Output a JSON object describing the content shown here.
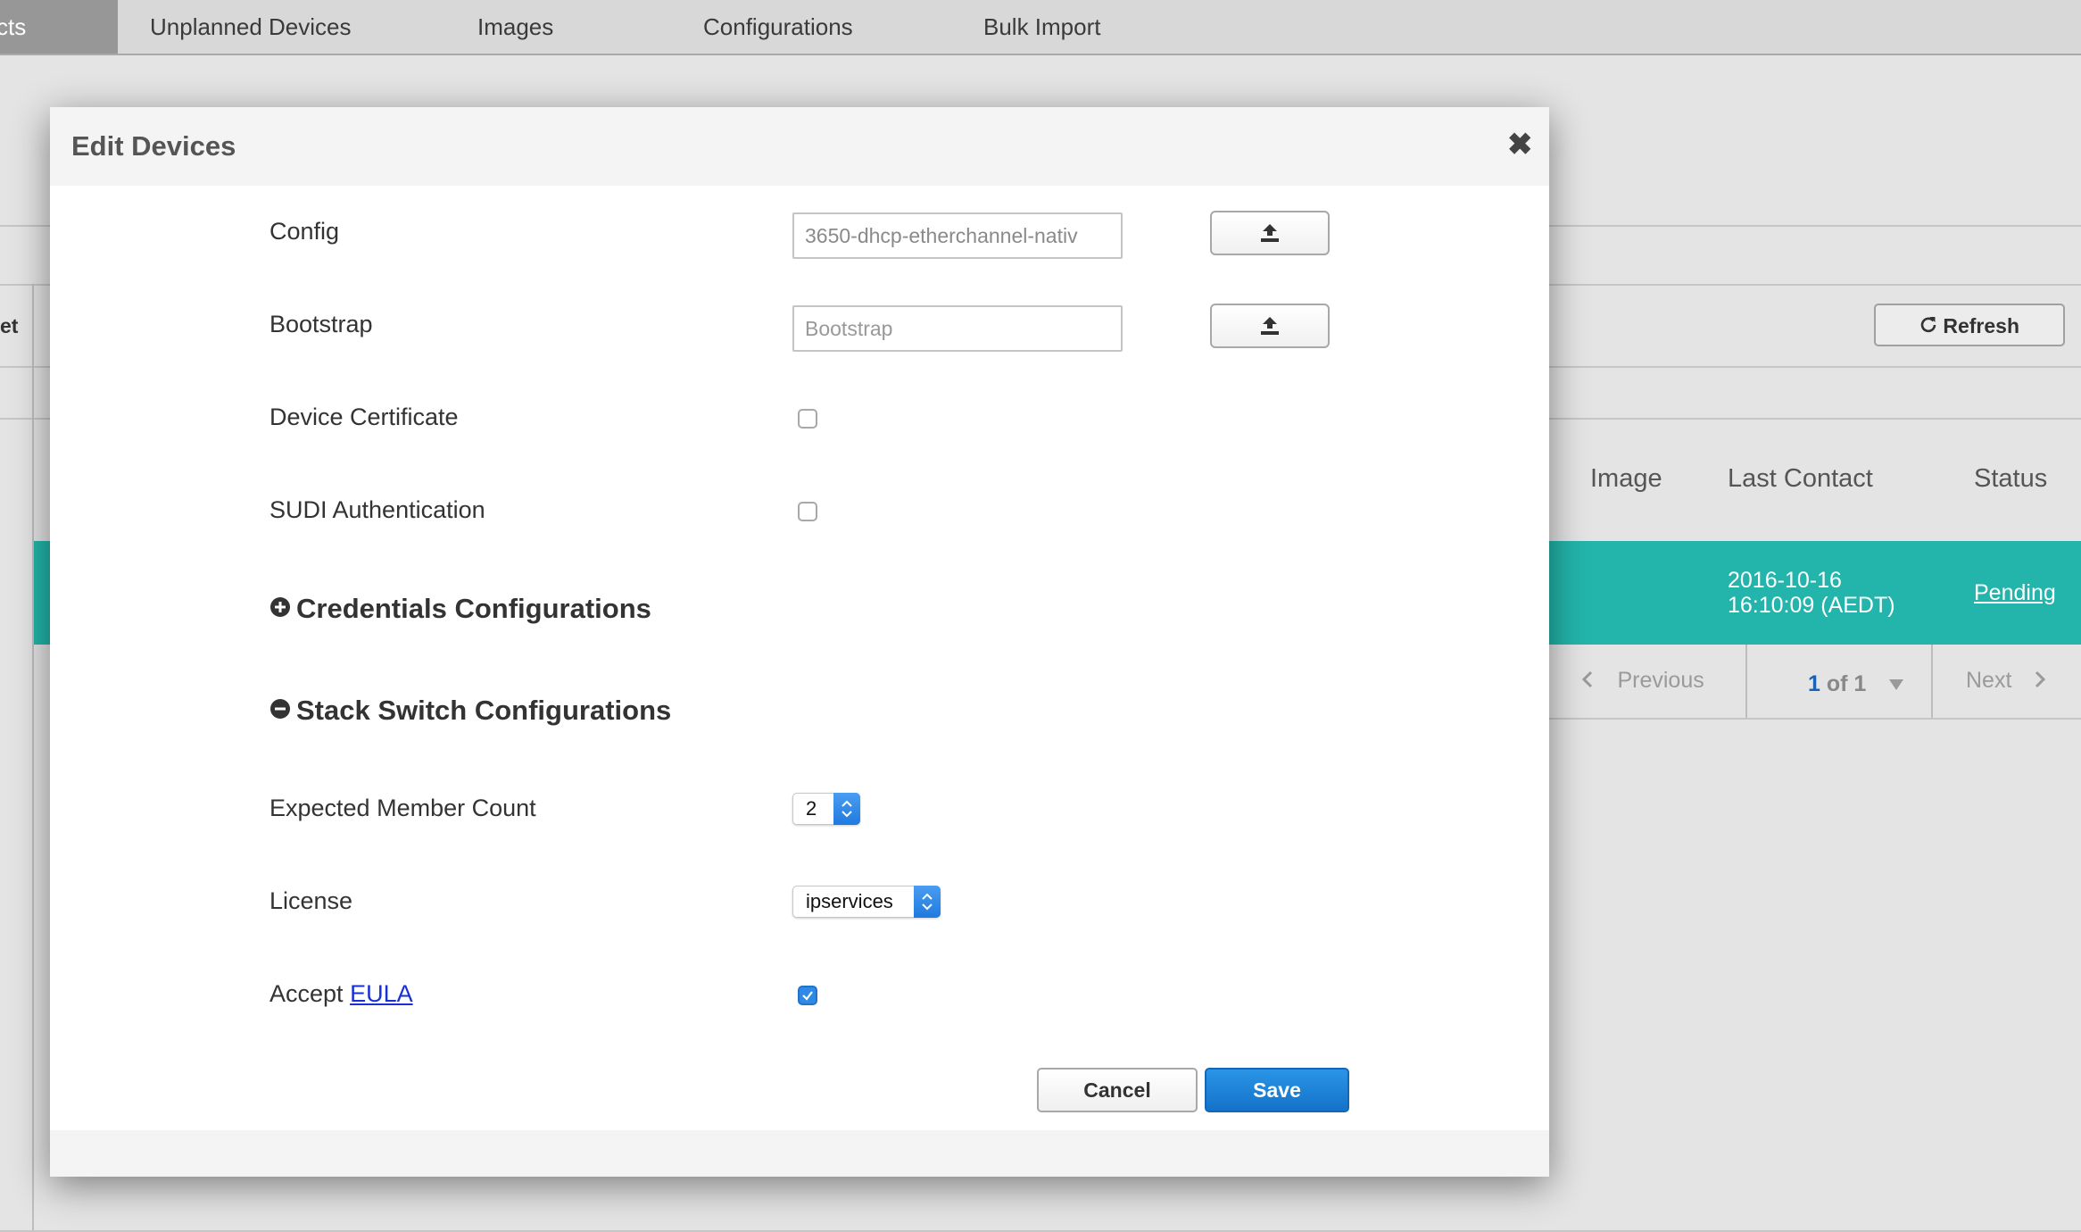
{
  "nav": {
    "active_tab": "cts",
    "tabs": [
      "Unplanned Devices",
      "Images",
      "Configurations",
      "Bulk Import"
    ]
  },
  "background": {
    "left_clip_label": "et",
    "refresh_label": "Refresh",
    "columns": [
      "Image",
      "Last Contact",
      "Status"
    ],
    "row": {
      "last_contact_date": "2016-10-16",
      "last_contact_time": "16:10:09 (AEDT)",
      "status": "Pending"
    },
    "pagination": {
      "previous": "Previous",
      "page_current": "1",
      "page_of": "of 1",
      "next": "Next"
    }
  },
  "modal": {
    "title": "Edit Devices",
    "fields": {
      "config_label": "Config",
      "config_value": "3650-dhcp-etherchannel-nativ",
      "bootstrap_label": "Bootstrap",
      "bootstrap_placeholder": "Bootstrap",
      "device_certificate_label": "Device Certificate",
      "device_certificate_checked": false,
      "sudi_label": "SUDI Authentication",
      "sudi_checked": false
    },
    "sections": {
      "credentials": "Credentials Configurations",
      "credentials_icon": "plus-circle-icon",
      "stack_switch": "Stack Switch Configurations",
      "stack_switch_icon": "minus-circle-icon"
    },
    "stack": {
      "member_count_label": "Expected Member Count",
      "member_count_value": "2",
      "license_label": "License",
      "license_value": "ipservices",
      "accept_label": "Accept",
      "eula_link": "EULA",
      "eula_checked": true
    },
    "buttons": {
      "cancel": "Cancel",
      "save": "Save"
    }
  },
  "colors": {
    "accent_teal": "#23b5ab",
    "save_blue": "#1a7fd6",
    "link_blue": "#1a2fd6"
  }
}
